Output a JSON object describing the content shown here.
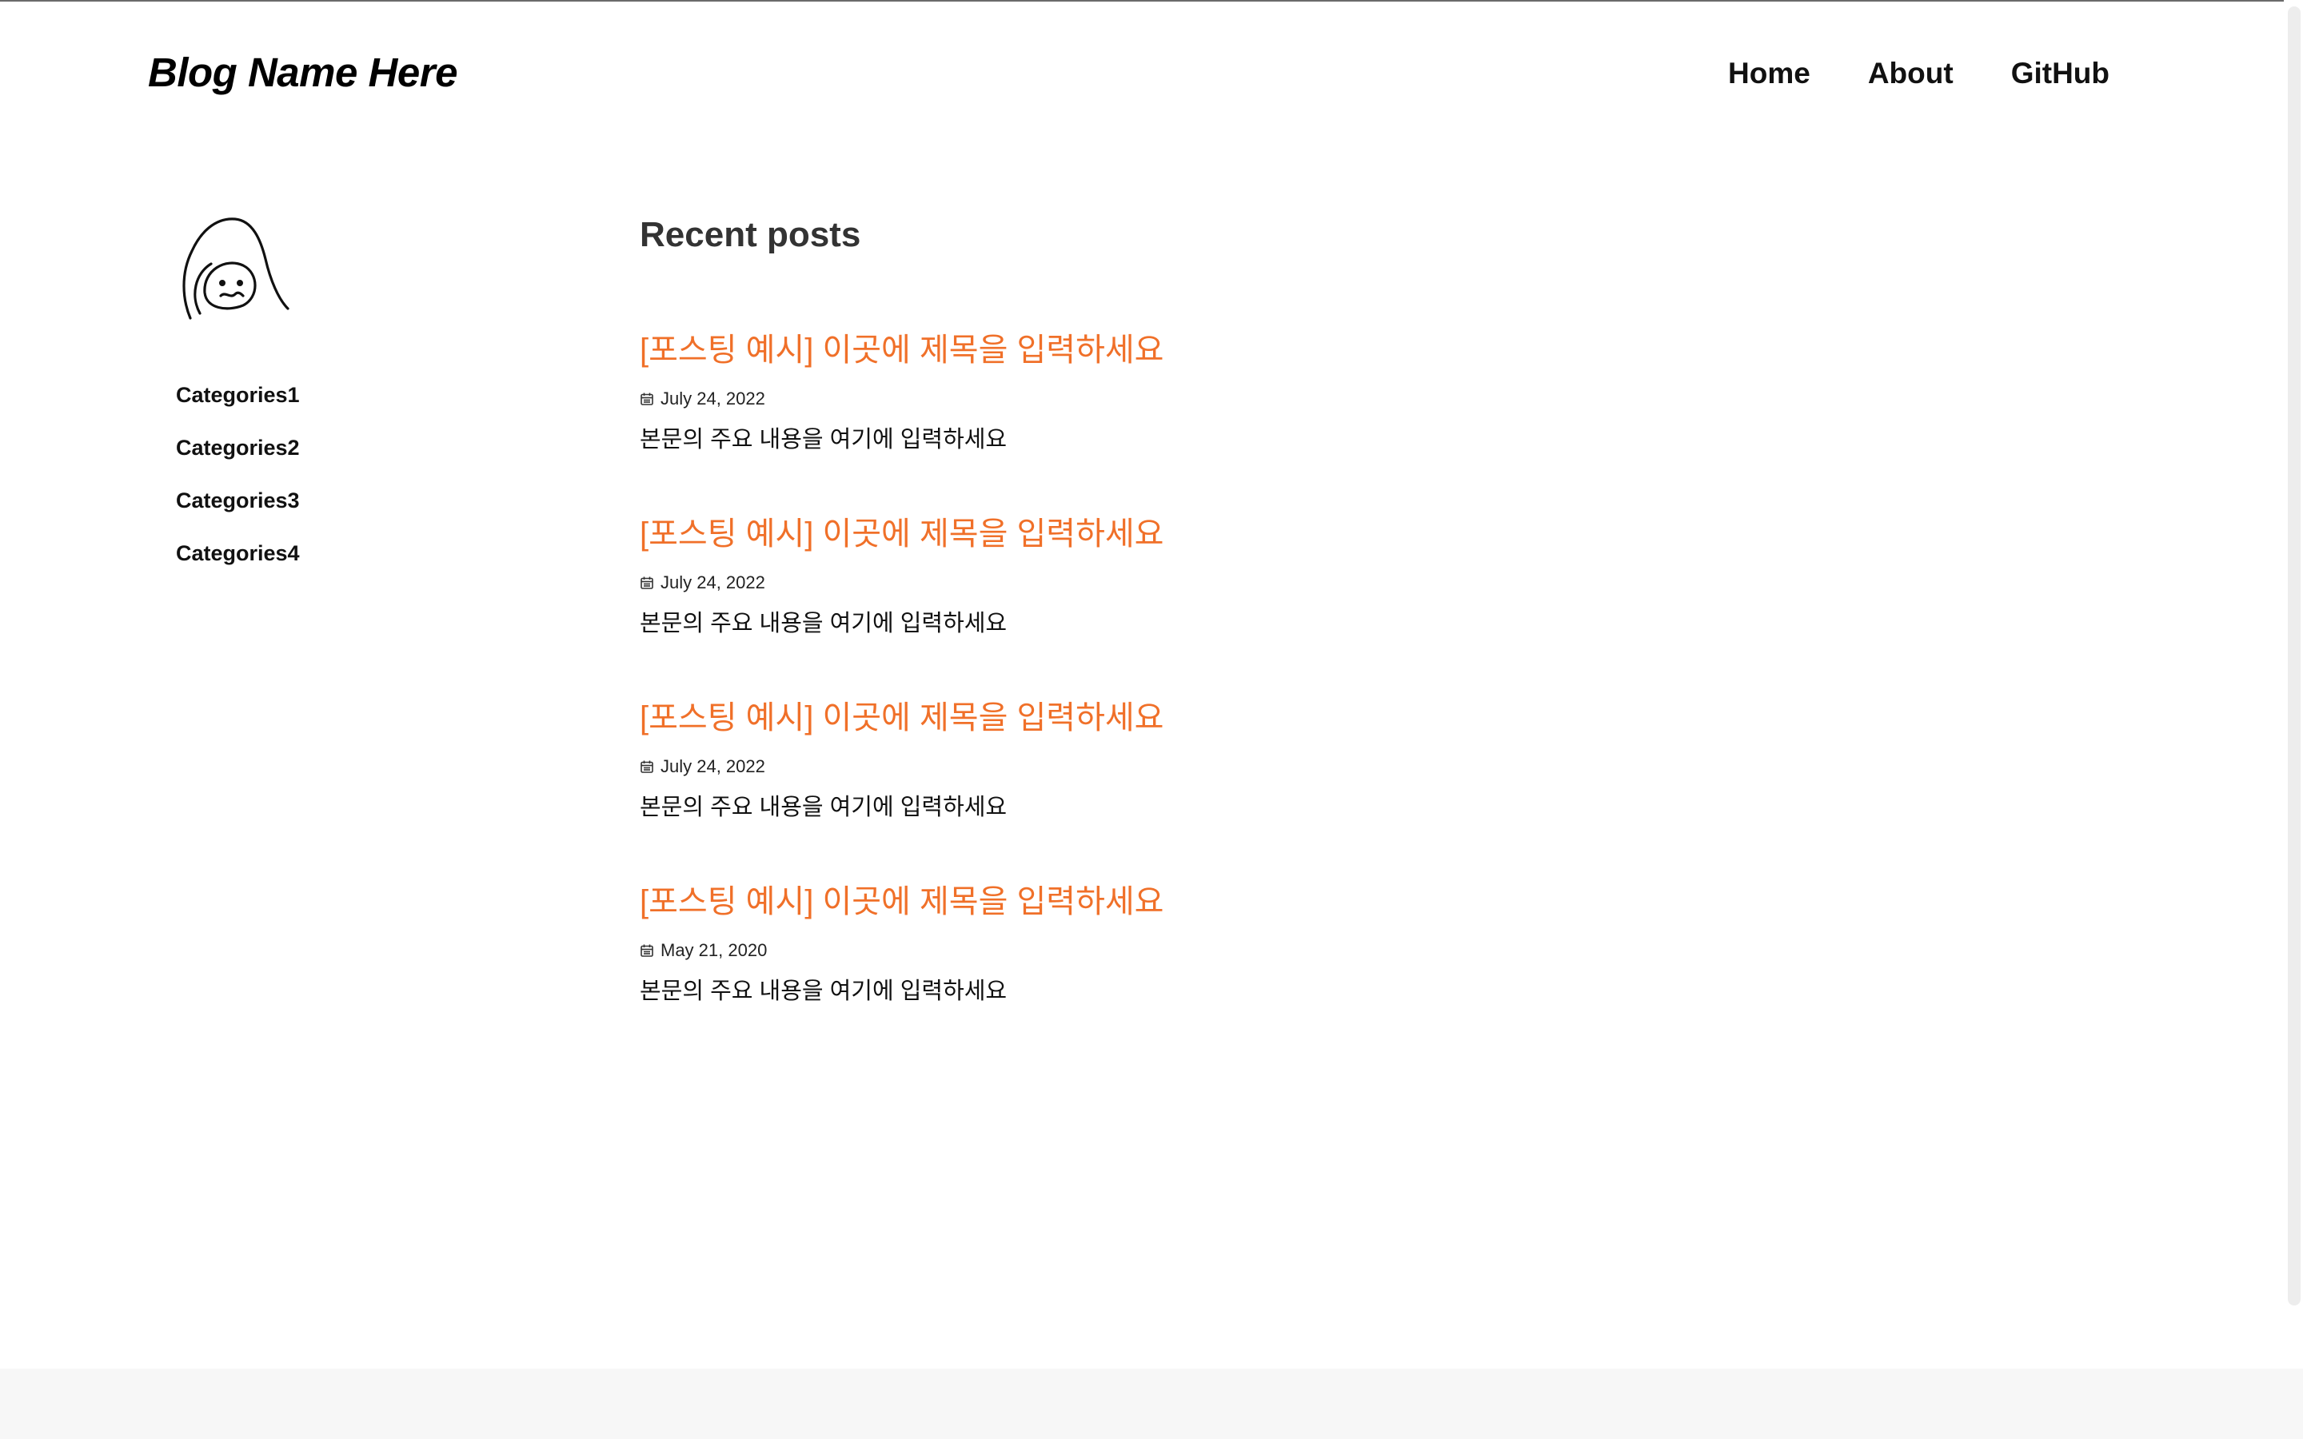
{
  "header": {
    "title": "Blog Name Here",
    "nav": [
      "Home",
      "About",
      "GitHub"
    ]
  },
  "sidebar": {
    "avatar_icon": "doodle-face-avatar",
    "categories": [
      "Categories1",
      "Categories2",
      "Categories3",
      "Categories4"
    ]
  },
  "main": {
    "section_title": "Recent posts",
    "posts": [
      {
        "title": "[포스팅 예시] 이곳에 제목을 입력하세요",
        "date": "July 24, 2022",
        "excerpt": "본문의 주요 내용을 여기에 입력하세요"
      },
      {
        "title": "[포스팅 예시] 이곳에 제목을 입력하세요",
        "date": "July 24, 2022",
        "excerpt": "본문의 주요 내용을 여기에 입력하세요"
      },
      {
        "title": "[포스팅 예시] 이곳에 제목을 입력하세요",
        "date": "July 24, 2022",
        "excerpt": "본문의 주요 내용을 여기에 입력하세요"
      },
      {
        "title": "[포스팅 예시] 이곳에 제목을 입력하세요",
        "date": "May 21, 2020",
        "excerpt": "본문의 주요 내용을 여기에 입력하세요"
      }
    ],
    "date_icon": "calendar-icon"
  },
  "colors": {
    "accent": "#f07029",
    "text": "#111111",
    "heading": "#333333",
    "footer_bg": "#f7f7f7"
  }
}
